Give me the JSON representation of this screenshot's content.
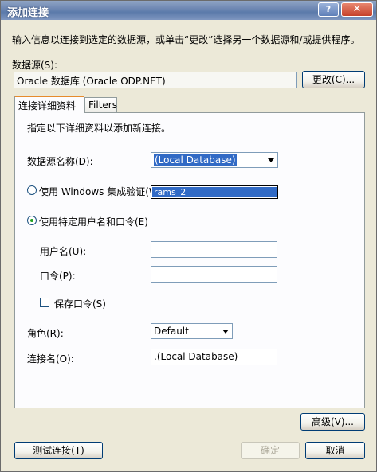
{
  "window": {
    "title": "添加连接",
    "help_glyph": "?",
    "close_glyph": "✕"
  },
  "instructions": "输入信息以连接到选定的数据源，或单击“更改”选择另一个数据源和/或提供程序。",
  "data_source": {
    "label": "数据源(S):",
    "value": "Oracle 数据库 (Oracle ODP.NET)",
    "change_button": "更改(C)..."
  },
  "tabs": [
    {
      "label": "连接详细资料"
    },
    {
      "label": "Filters"
    }
  ],
  "panel": {
    "intro": "指定以下详细资料以添加新连接。",
    "ds_name": {
      "label": "数据源名称(D):",
      "value": "(Local Database)",
      "dropdown_item": "rams_2"
    },
    "windows_auth": {
      "label": "使用 Windows 集成验证(W)",
      "selected": false
    },
    "specific_user": {
      "label": "使用特定用户名和口令(E)",
      "selected": true
    },
    "username": {
      "label": "用户名(U):",
      "value": ""
    },
    "password": {
      "label": "口令(P):",
      "value": ""
    },
    "save_password": {
      "label": "保存口令(S)",
      "checked": false
    },
    "role": {
      "label": "角色(R):",
      "value": "Default"
    },
    "connection_name": {
      "label": "连接名(O):",
      "value": ".(Local Database)"
    }
  },
  "buttons": {
    "advanced": "高级(V)...",
    "test": "测试连接(T)",
    "ok": "确定",
    "cancel": "取消"
  }
}
